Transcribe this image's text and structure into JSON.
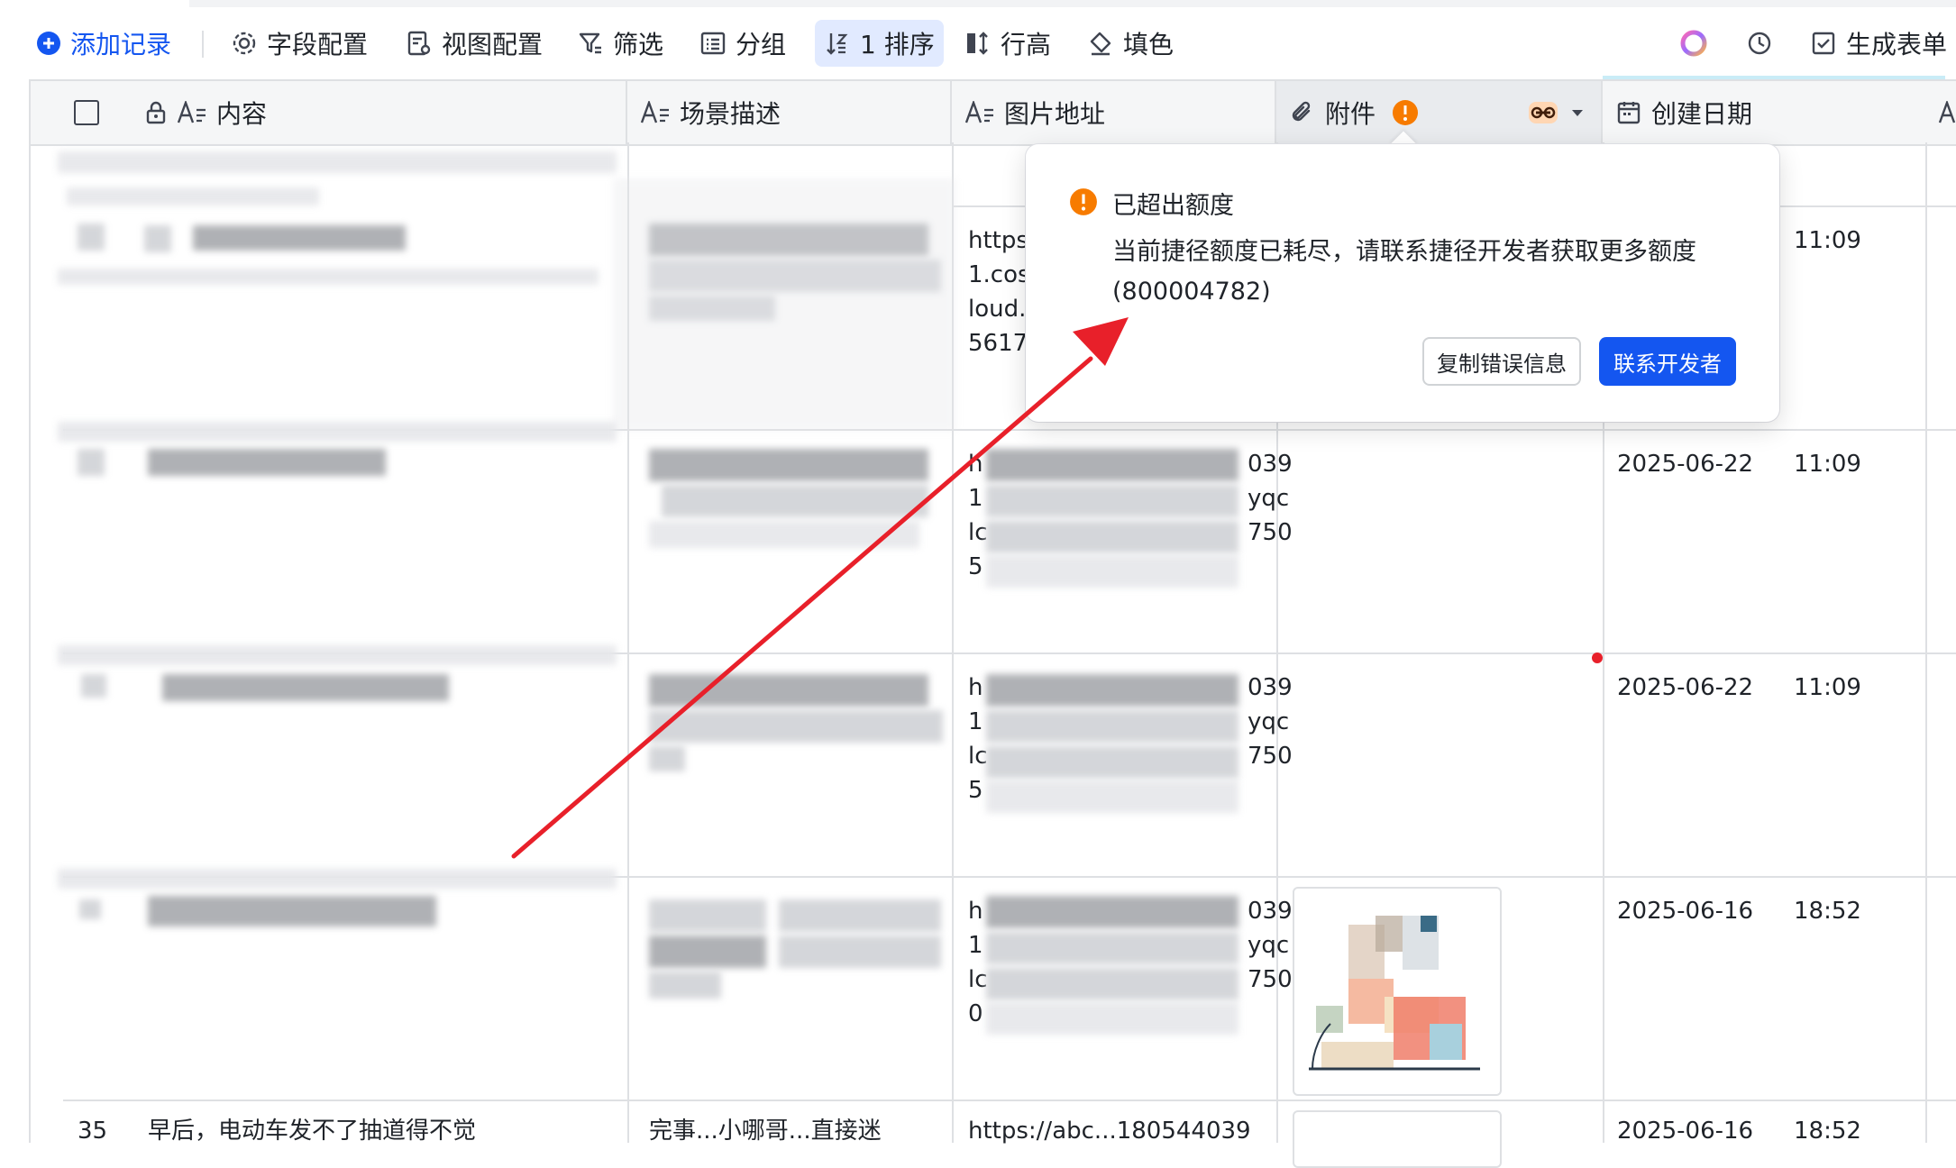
{
  "toolbar": {
    "add_record": "添加记录",
    "field_config": "字段配置",
    "view_config": "视图配置",
    "filter": "筛选",
    "group": "分组",
    "sort": "1 排序",
    "row_height": "行高",
    "fill_color": "填色",
    "generate_form": "生成表单"
  },
  "columns": {
    "content": "内容",
    "scene": "场景描述",
    "image_url": "图片地址",
    "attachment": "附件",
    "created": "创建日期"
  },
  "rows": [
    {
      "url_lines": [
        "https",
        "1.cos",
        "loud.c",
        "5617"
      ],
      "date": "",
      "time": "11:09"
    },
    {
      "url_suffix": [
        "039",
        "yqc",
        "750",
        ""
      ],
      "url_prefix": [
        "h",
        "1",
        "lc",
        "5"
      ],
      "date": "2025-06-22",
      "time": "11:09"
    },
    {
      "url_suffix": [
        "039",
        "yqc",
        "750",
        ""
      ],
      "url_prefix": [
        "h",
        "1",
        "lc",
        "5"
      ],
      "date": "2025-06-22",
      "time": "11:09"
    },
    {
      "url_suffix": [
        "039",
        "yqc",
        "750",
        ""
      ],
      "url_prefix": [
        "h",
        "1",
        "lc",
        "0"
      ],
      "date": "2025-06-16",
      "time": "18:52"
    }
  ],
  "partial_row": {
    "num": "35",
    "content": "早后，电动车发不了抽道得不觉",
    "scene": "完事...小哪哥...直接迷",
    "url": "https://abc...180544039",
    "date": "2025-06-16",
    "time": "18:52"
  },
  "popover": {
    "title": "已超出额度",
    "message": "当前捷径额度已耗尽，请联系捷径开发者获取更多额度 (800004782)",
    "copy_button": "复制错误信息",
    "contact_button": "联系开发者"
  },
  "colors": {
    "accent": "#1456f0",
    "warning": "#f77b00",
    "arrow": "#e8202a"
  }
}
